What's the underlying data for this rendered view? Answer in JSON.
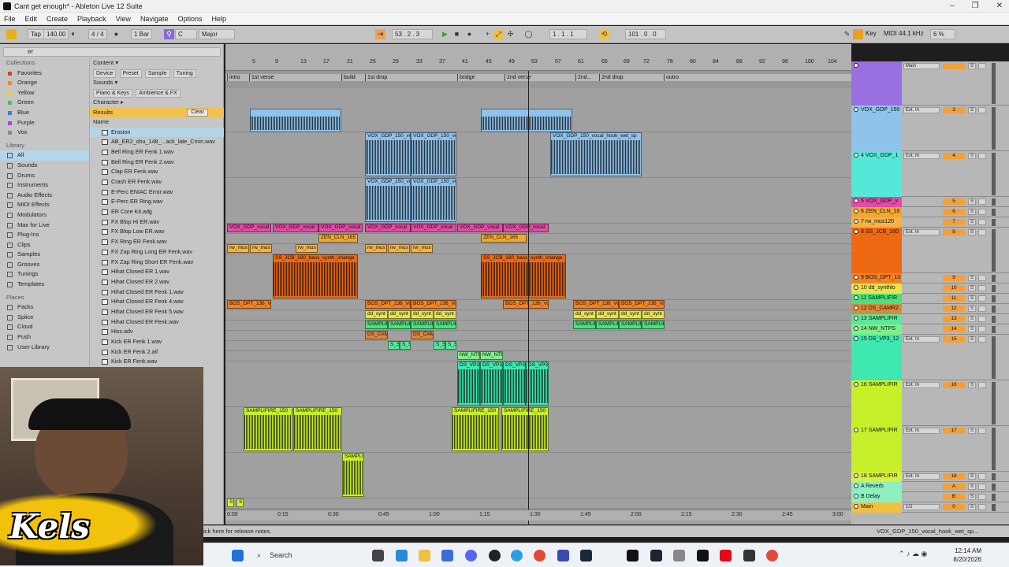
{
  "window": {
    "title": "Cant get enough* - Ableton Live 12 Suite",
    "minimize": "–",
    "restore": "❐",
    "close": "✕"
  },
  "menu": [
    "File",
    "Edit",
    "Create",
    "Playback",
    "View",
    "Navigate",
    "Options",
    "Help"
  ],
  "transport": {
    "tap": "Tap",
    "tempo": "140.00",
    "signature": "4 / 4",
    "quantize": "1 Bar",
    "key_root": "C",
    "scale": "Major",
    "position": "53 .   2 .   3",
    "loop_start": "1 .   1 .   1",
    "loop_length": "101 .   0 .   0",
    "key_label": "Key",
    "midi_label": "MIDI",
    "sample_rate": "44.1 kHz",
    "cpu": "6 %"
  },
  "browser": {
    "search_value": "er",
    "collections_header": "Collections",
    "collections": [
      {
        "label": "Favorites",
        "color": "#e03b2f"
      },
      {
        "label": "Orange",
        "color": "#f08a24"
      },
      {
        "label": "Yellow",
        "color": "#e8d02a"
      },
      {
        "label": "Green",
        "color": "#4cc24a"
      },
      {
        "label": "Blue",
        "color": "#3b7de0"
      },
      {
        "label": "Purple",
        "color": "#9b4de0"
      },
      {
        "label": "Vox",
        "color": "#8a8a8a"
      }
    ],
    "library_header": "Library",
    "library": [
      "All",
      "Sounds",
      "Drums",
      "Instruments",
      "Audio Effects",
      "MIDI Effects",
      "Modulators",
      "Max for Live",
      "Plug-Ins",
      "Clips",
      "Samples",
      "Grooves",
      "Tunings",
      "Templates"
    ],
    "places_header": "Places",
    "places": [
      "Packs",
      "Splice",
      "Cloud",
      "Push",
      "User Library"
    ],
    "content_label": "Content ▾",
    "filter_tabs": [
      "Device",
      "Preset",
      "Sample",
      "Tuning"
    ],
    "sounds_label": "Sounds ▾",
    "chips": [
      "Piano & Keys",
      "Ambience & FX"
    ],
    "character_label": "Character ▸",
    "results_label": "Results",
    "clear_label": "Clear",
    "name_header": "Name",
    "files": [
      "Erosion",
      "AB_ER2_ohu_148_...ack_late_Cmin.wav",
      "Bell Ring ER Fenk 1.wav",
      "Bell Ring ER Fenk 2.wav",
      "Clap ER Fenk.wav",
      "Crash ER Fenk.wav",
      "E-Perc ENIAC Error.wav",
      "E-Perc ER Ring.wav",
      "ER Core Kit.adg",
      "FX Blop Hi ER.wav",
      "FX Blop Low ER.wav",
      "FX Ring ER Fenk.wav",
      "FX Zap Ring Long ER Fenk.wav",
      "FX Zap Ring Short ER Fenk.wav",
      "Hihat Closed ER 1.wav",
      "Hihat Closed ER 2.wav",
      "Hihat Closed ER Fenk 1.wav",
      "Hihat Closed ER Fenk 4.wav",
      "Hihat Closed ER Fenk 5.wav",
      "Hihat Closed ER Fenk.wav",
      "Hiss.adv",
      "Kick ER Fenk 1.wav",
      "Kick ER Fenk 2.aif",
      "Kick ER Fenk.wav"
    ]
  },
  "ruler": {
    "bars": [
      "5",
      "9",
      "13",
      "17",
      "21",
      "25",
      "29",
      "33",
      "37",
      "41",
      "45",
      "49",
      "53",
      "57",
      "61",
      "65",
      "69",
      "72",
      "76",
      "80",
      "84",
      "88",
      "92",
      "96",
      "100",
      "104"
    ],
    "signature": "4/4"
  },
  "locators": [
    "intro",
    "1st verse",
    "build",
    "1st drop",
    "bridge",
    "2nd verse",
    "2nd...",
    "2nd drop",
    "outro"
  ],
  "time_axis": [
    "0:00",
    "0:15",
    "0:30",
    "0:45",
    "1:00",
    "1:15",
    "1:30",
    "1:45",
    "2:00",
    "2:15",
    "2:30",
    "2:45",
    "3:00"
  ],
  "clip_names": {
    "vox_gdp": "VOX_GDP_150_vo",
    "vox_hook": "VOX_GDP_150_vocal_hook_wet_sp",
    "vox_pink": "VOX_GDP_vocal",
    "zen": "ZEN_CLN_165",
    "rw": "rw_mus",
    "ss_jcb": "SS_JCB_160_bass_synth_change",
    "bos": "BOS_DPT_136_Vo",
    "dd": "dd_synt",
    "samp": "SAMPLIF",
    "ds_cam": "DS_CAM",
    "ss_san": "S_SAN",
    "nw": "NW_NTF",
    "ds_vp": "DS_VP3",
    "samplifire": "SAMPLIFIRE_150",
    "samplif_short": "SAMPLIF",
    "s": "S"
  },
  "tracks": [
    {
      "name": "",
      "io": "Main",
      "num": "",
      "color": "#9a6fe0"
    },
    {
      "name": "VOX_GDP_150",
      "io": "Ext. In",
      "num": "3",
      "color": "#8fc3ec"
    },
    {
      "name": "4 VOX_GDP_1",
      "io": "Ext. In",
      "num": "4",
      "color": "#55e8d8"
    },
    {
      "name": "5 VOX_GDP_v",
      "io": "",
      "num": "5",
      "color": "#e24ba6"
    },
    {
      "name": "6 ZEN_CLN_16",
      "io": "",
      "num": "6",
      "color": "#f0a830"
    },
    {
      "name": "7 rw_mus120",
      "io": "",
      "num": "7",
      "color": "#f2b347"
    },
    {
      "name": "8 SS_JCB_160",
      "io": "Ext. In",
      "num": "8",
      "color": "#ee6a12"
    },
    {
      "name": "9 BOS_DPT_13",
      "io": "",
      "num": "9",
      "color": "#f28224"
    },
    {
      "name": "10 dd_synthlo",
      "io": "",
      "num": "10",
      "color": "#e8e34a"
    },
    {
      "name": "11 SAMPLIFIR",
      "io": "",
      "num": "11",
      "color": "#4be07c"
    },
    {
      "name": "12 DS_CAMR2",
      "io": "",
      "num": "12",
      "color": "#d88a3c"
    },
    {
      "name": "13 SAMPLIFIR",
      "io": "",
      "num": "13",
      "color": "#5ae89a"
    },
    {
      "name": "14 NW_NTPS",
      "io": "",
      "num": "14",
      "color": "#7ef08a"
    },
    {
      "name": "15 DS_VP3_12",
      "io": "Ext. In",
      "num": "15",
      "color": "#3ee8b0"
    },
    {
      "name": "16 SAMPLIFIR",
      "io": "Ext. In",
      "num": "16",
      "color": "#c8f02a"
    },
    {
      "name": "17 SAMPLIFIR",
      "io": "Ext. In",
      "num": "17",
      "color": "#c8f02a"
    },
    {
      "name": "18 SAMPLIFIR",
      "io": "Ext. In",
      "num": "18",
      "color": "#d8f040"
    },
    {
      "name": "A Reverb",
      "io": "",
      "num": "A",
      "color": "#8ef0c0"
    },
    {
      "name": "B Delay",
      "io": "",
      "num": "B",
      "color": "#8ef0c0"
    },
    {
      "name": "Main",
      "io": "1/2",
      "num": "0",
      "color": "#f0c040"
    }
  ],
  "status": {
    "message": "Click here for release notes.",
    "selected_clip": "VOX_GDP_150_vocal_hook_wet_sp..."
  },
  "taskbar": {
    "search_placeholder": "Search",
    "time": "12:14 AM",
    "date": "8/20/2026"
  },
  "overlay": {
    "watermark": "Kels"
  }
}
